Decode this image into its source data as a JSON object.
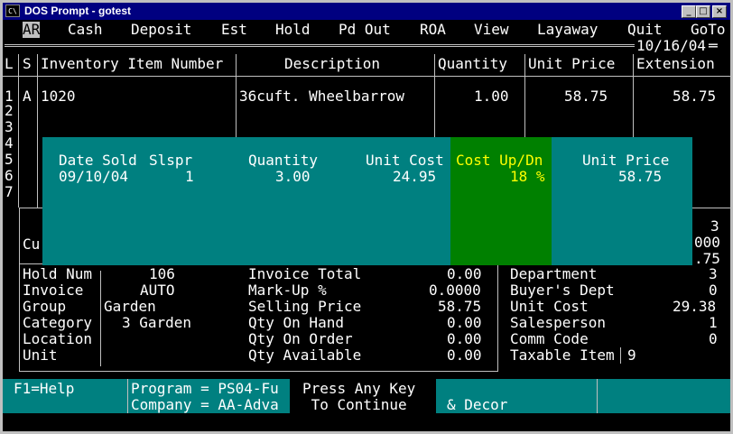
{
  "window": {
    "title": "DOS Prompt - gotest",
    "icon_label": "C\\",
    "buttons": [
      "minimize-icon",
      "maximize-icon",
      "close-icon"
    ]
  },
  "menu": {
    "items": [
      "AR",
      "Cash",
      "Deposit",
      "Est",
      "Hold",
      "Pd Out",
      "ROA",
      "View",
      "Layaway",
      "Quit",
      "GoTo"
    ],
    "date": "10/16/04"
  },
  "grid": {
    "headers": [
      "L",
      "S",
      "Inventory Item Number",
      "Description",
      "Quantity",
      "Unit Price",
      "Extension"
    ],
    "line_numbers": [
      "1",
      "2",
      "3",
      "4",
      "5",
      "6",
      "7"
    ],
    "row": {
      "status": "A",
      "item_number": "1020",
      "description": "36cuft. Wheelbarrow",
      "quantity": "1.00",
      "unit_price": "58.75",
      "extension": "58.75"
    }
  },
  "popup": {
    "headers": {
      "date_sold": "Date Sold",
      "slspr": "Slspr",
      "quantity": "Quantity",
      "unit_cost": "Unit Cost",
      "cost_updn": "Cost Up/Dn",
      "unit_price": "Unit Price"
    },
    "row": {
      "date_sold": "09/10/04",
      "slspr": "1",
      "quantity": "3.00",
      "unit_cost": "24.95",
      "cost_updn": "18 %",
      "unit_price": "58.75"
    }
  },
  "partial": {
    "left_label": "Cu",
    "right_values": [
      "3",
      "000",
      ".75"
    ]
  },
  "details": {
    "left": [
      {
        "label": "Hold Num",
        "value": "106"
      },
      {
        "label": "Invoice",
        "value": "AUTO"
      },
      {
        "label": "Group",
        "value": "Garden"
      },
      {
        "label": "Category",
        "value": "3 Garden"
      },
      {
        "label": "Location",
        "value": ""
      },
      {
        "label": "Unit",
        "value": ""
      }
    ],
    "middle": [
      {
        "label": "Invoice Total",
        "value": "0.00"
      },
      {
        "label": "Mark-Up %",
        "value": "0.0000"
      },
      {
        "label": "Selling Price",
        "value": "58.75"
      },
      {
        "label": "Qty On Hand",
        "value": "0.00"
      },
      {
        "label": "Qty On Order",
        "value": "0.00"
      },
      {
        "label": "Qty Available",
        "value": "0.00"
      }
    ],
    "right": [
      {
        "label": "Department",
        "value": "3"
      },
      {
        "label": "Buyer's Dept",
        "value": "0"
      },
      {
        "label": "Unit Cost",
        "value": "29.38"
      },
      {
        "label": "Salesperson",
        "value": "1"
      },
      {
        "label": "Comm Code",
        "value": "0"
      },
      {
        "label": "Taxable Item",
        "value": "9"
      }
    ]
  },
  "status": {
    "help": "F1=Help",
    "program": "Program = PS04-Fu",
    "company": "Company = AA-Adva",
    "prompt1": "Press Any Key",
    "prompt2": " To Continue",
    "extra": "& Decor"
  }
}
